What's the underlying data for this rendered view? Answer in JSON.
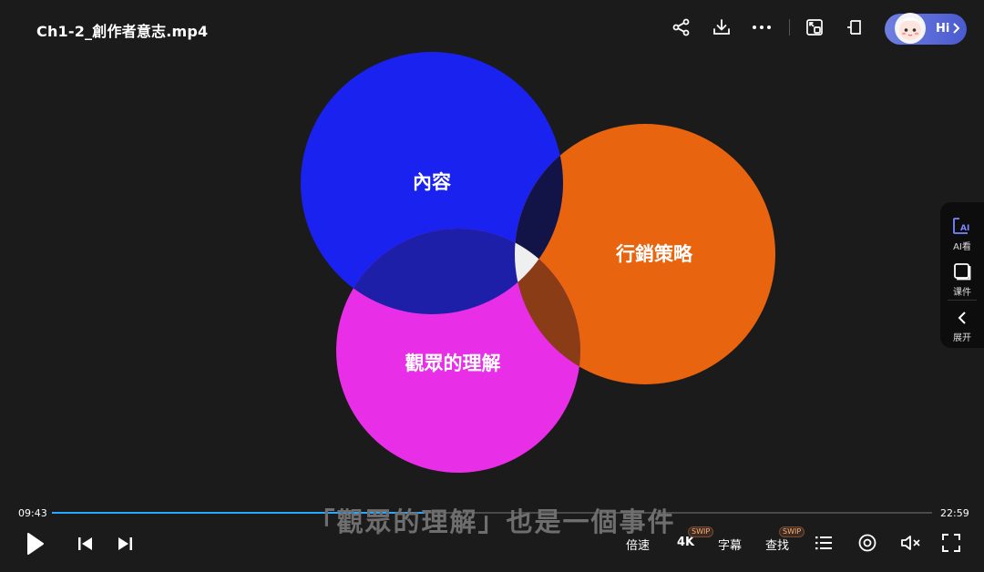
{
  "header": {
    "title": "Ch1-2_創作者意志.mp4",
    "icons": [
      "share-icon",
      "download-icon",
      "more-icon",
      "picture-in-picture-icon",
      "mini-window-icon"
    ],
    "ai_label": "Hi"
  },
  "side_panel": {
    "items": [
      {
        "label": "AI看"
      },
      {
        "label": "课件"
      },
      {
        "label": "展开"
      }
    ]
  },
  "venn": {
    "circles": [
      {
        "label": "內容",
        "color": "#1a22ef"
      },
      {
        "label": "行銷策略",
        "color": "#e8640f"
      },
      {
        "label": "觀眾的理解",
        "color": "#e82ee6"
      }
    ]
  },
  "player": {
    "current_time": "09:43",
    "total_time": "22:59",
    "progress": 0.423,
    "subtitle": "「觀眾的理解」也是一個事件",
    "speed_label": "倍速",
    "quality_label": "4K",
    "subtitle_label": "字幕",
    "search_label": "查找",
    "badge": "SWIP"
  },
  "colors": {
    "accent": "#2aa7ff",
    "background": "#1b1b1c"
  }
}
